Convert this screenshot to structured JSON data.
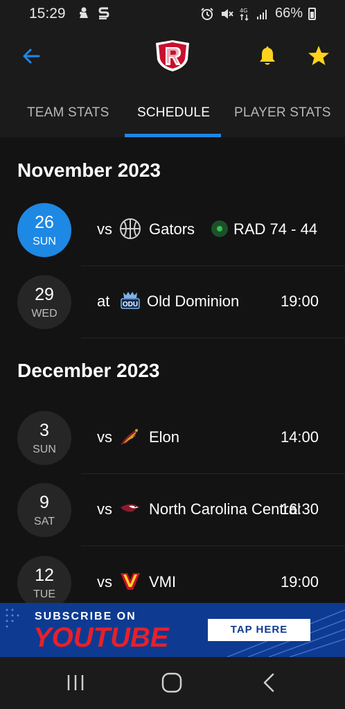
{
  "status_bar": {
    "time": "15:29",
    "battery": "66%"
  },
  "app_bar": {
    "back_icon": "arrow-left-icon",
    "logo_icon": "radford-r-logo",
    "bell_icon": "bell-icon",
    "star_icon": "star-icon",
    "accent_color": "#1e88e5",
    "icon_color": "#ffd21f"
  },
  "tabs": {
    "partial_left": "·",
    "items": [
      {
        "label": "TEAM STATS"
      },
      {
        "label": "SCHEDULE"
      },
      {
        "label": "PLAYER STATS"
      }
    ],
    "active": "SCHEDULE"
  },
  "schedule": {
    "months": [
      {
        "title": "November 2023",
        "games": [
          {
            "day": "26",
            "dow": "SUN",
            "prefix": "vs",
            "team": "Gators",
            "result": "RAD 74 - 44",
            "highlight": true
          },
          {
            "day": "29",
            "dow": "WED",
            "prefix": "at",
            "team": "Old Dominion",
            "time": "19:00"
          }
        ]
      },
      {
        "title": "December 2023",
        "games": [
          {
            "day": "3",
            "dow": "SUN",
            "prefix": "vs",
            "team": "Elon",
            "time": "14:00"
          },
          {
            "day": "9",
            "dow": "SAT",
            "prefix": "vs",
            "team": "North Carolina Central",
            "time": "16:30"
          },
          {
            "day": "12",
            "dow": "TUE",
            "prefix": "vs",
            "team": "VMI",
            "time": "19:00"
          }
        ]
      }
    ]
  },
  "banner": {
    "subtitle": "SUBSCRIBE ON",
    "title": "YOUTUBE",
    "cta": "TAP HERE"
  },
  "nav_bar": {
    "recents_icon": "recent-apps-icon",
    "home_icon": "home-icon",
    "back_icon": "nav-back-icon"
  }
}
